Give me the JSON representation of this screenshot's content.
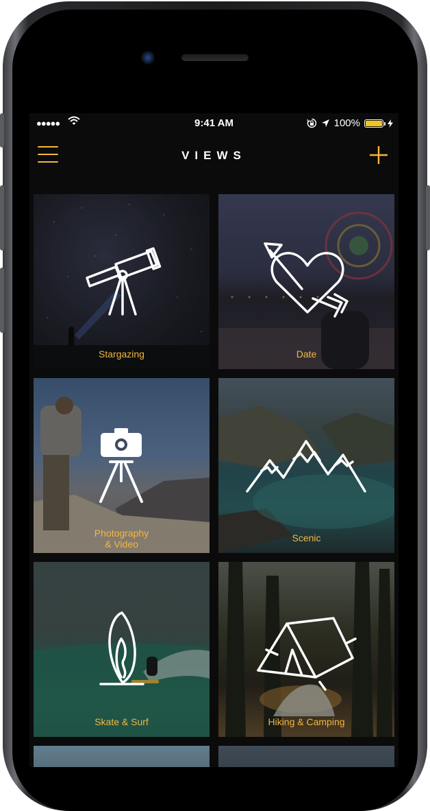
{
  "status_bar": {
    "signal": "●●●●●",
    "time": "9:41 AM",
    "battery_percent": "100%",
    "battery_level": 1.0,
    "battery_color": "#f5c518"
  },
  "header": {
    "title": "VIEWS",
    "menu_icon": "hamburger-icon",
    "add_icon": "plus-icon",
    "accent_color": "#f4b73e"
  },
  "tiles": [
    {
      "label": "Stargazing",
      "icon": "telescope-icon"
    },
    {
      "label": "Date",
      "icon": "heart-arrow-icon"
    },
    {
      "label": "Photography\n& Video",
      "label_line1": "Photography",
      "label_line2": "& Video",
      "icon": "camera-tripod-icon"
    },
    {
      "label": "Scenic",
      "icon": "mountains-icon"
    },
    {
      "label": "Skate & Surf",
      "icon": "surfboard-icon"
    },
    {
      "label": "Hiking & Camping",
      "icon": "tent-icon"
    }
  ]
}
